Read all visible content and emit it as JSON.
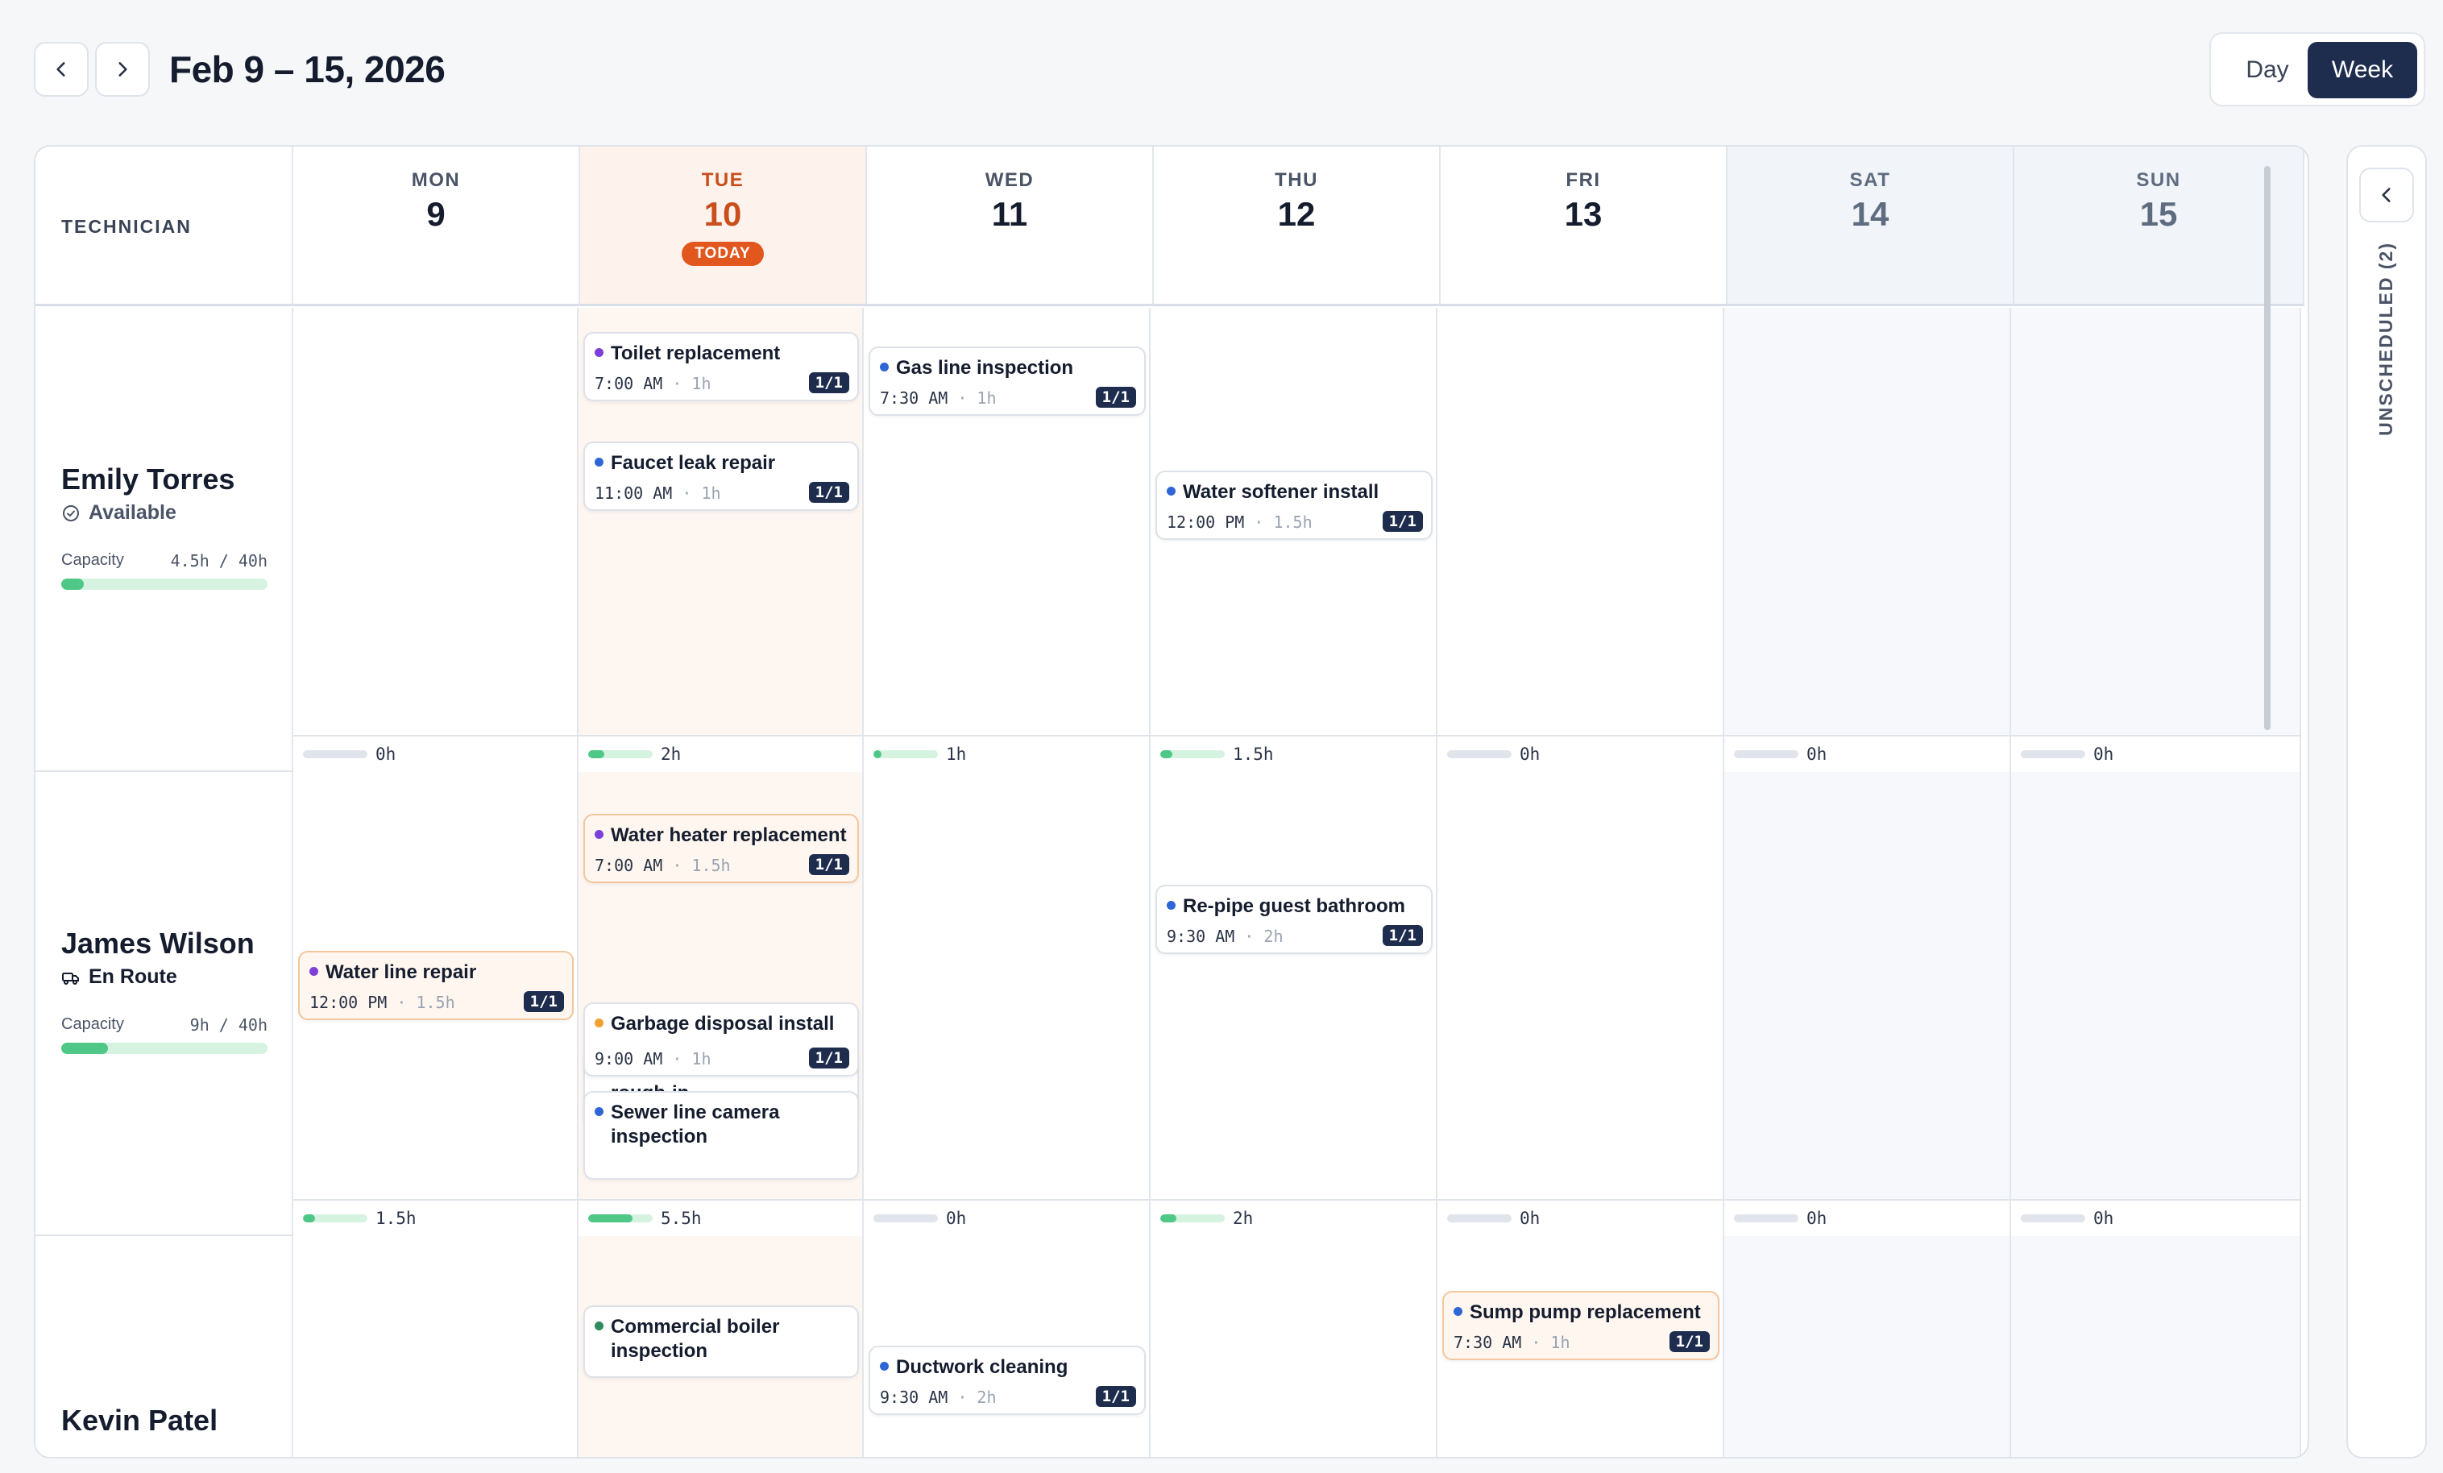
{
  "header": {
    "title": "Feb 9 – 15, 2026",
    "prev_icon": "chevron-left-icon",
    "next_icon": "chevron-right-icon"
  },
  "view_toggle": {
    "day": "Day",
    "week": "Week",
    "active": "Week"
  },
  "grid": {
    "tech_header": "TECHNICIAN",
    "days": [
      {
        "name": "MON",
        "date": "9",
        "today": false,
        "weekend": false
      },
      {
        "name": "TUE",
        "date": "10",
        "today": true,
        "weekend": false,
        "today_label": "TODAY"
      },
      {
        "name": "WED",
        "date": "11",
        "today": false,
        "weekend": false
      },
      {
        "name": "THU",
        "date": "12",
        "today": false,
        "weekend": false
      },
      {
        "name": "FRI",
        "date": "13",
        "today": false,
        "weekend": false
      },
      {
        "name": "SAT",
        "date": "14",
        "today": false,
        "weekend": true
      },
      {
        "name": "SUN",
        "date": "15",
        "today": false,
        "weekend": true
      }
    ]
  },
  "technicians": [
    {
      "name": "Emily Torres",
      "status": "Available",
      "status_icon": "check-circle-icon",
      "capacity_label": "Capacity",
      "capacity_value": "4.5h / 40h",
      "capacity_fraction": 0.11,
      "day_totals": [
        {
          "label": "0h",
          "fraction": 0
        },
        {
          "label": "2h",
          "fraction": 0.25
        },
        {
          "label": "1h",
          "fraction": 0.12
        },
        {
          "label": "1.5h",
          "fraction": 0.19
        },
        {
          "label": "0h",
          "fraction": 0
        },
        {
          "label": "0h",
          "fraction": 0
        },
        {
          "label": "0h",
          "fraction": 0
        }
      ],
      "jobs": [
        {
          "title": "Toilet replacement",
          "time": "7:00 AM",
          "duration": "1h",
          "badge": "1/1",
          "dot_color": "#7c3fd8",
          "highlight": false
        },
        {
          "title": "Faucet leak repair",
          "time": "11:00 AM",
          "duration": "1h",
          "badge": "1/1",
          "dot_color": "#2f66d6",
          "highlight": false
        },
        {
          "title": "Gas line inspection",
          "time": "7:30 AM",
          "duration": "1h",
          "badge": "1/1",
          "dot_color": "#2f66d6",
          "highlight": false
        },
        {
          "title": "Water softener install",
          "time": "12:00 PM",
          "duration": "1.5h",
          "badge": "1/1",
          "dot_color": "#2f66d6",
          "highlight": false
        }
      ]
    },
    {
      "name": "James Wilson",
      "status": "En Route",
      "status_icon": "truck-icon",
      "capacity_label": "Capacity",
      "capacity_value": "9h / 40h",
      "capacity_fraction": 0.225,
      "day_totals": [
        {
          "label": "1.5h",
          "fraction": 0.19
        },
        {
          "label": "5.5h",
          "fraction": 0.69
        },
        {
          "label": "0h",
          "fraction": 0
        },
        {
          "label": "2h",
          "fraction": 0.25
        },
        {
          "label": "0h",
          "fraction": 0
        },
        {
          "label": "0h",
          "fraction": 0
        },
        {
          "label": "0h",
          "fraction": 0
        }
      ],
      "jobs": [
        {
          "title": "Water line repair",
          "time": "12:00 PM",
          "duration": "1.5h",
          "badge": "1/1",
          "dot_color": "#7c3fd8",
          "highlight": true
        },
        {
          "title": "Bathroom remodel rough-in",
          "time": "",
          "duration": "",
          "badge": "",
          "dot_color": "#2f66d6",
          "highlight": false
        },
        {
          "title": "Sewer line camera inspection",
          "time": "",
          "duration": "",
          "badge": "",
          "dot_color": "#2f66d6",
          "highlight": false
        },
        {
          "title": "Garbage disposal install",
          "time": "9:00 AM",
          "duration": "1h",
          "badge": "1/1",
          "dot_color": "#f0a030",
          "highlight": false
        },
        {
          "title": "Water heater replacement",
          "time": "7:00 AM",
          "duration": "1.5h",
          "badge": "1/1",
          "dot_color": "#7c3fd8",
          "highlight": true
        },
        {
          "title": "Re-pipe guest bathroom",
          "time": "9:30 AM",
          "duration": "2h",
          "badge": "1/1",
          "dot_color": "#2f66d6",
          "highlight": false
        }
      ]
    },
    {
      "name": "Kevin Patel",
      "jobs": [
        {
          "title": "Commercial boiler inspection",
          "time": "",
          "duration": "",
          "badge": "",
          "dot_color": "#2f8a5e",
          "highlight": false
        },
        {
          "title": "Ductwork cleaning",
          "time": "9:30 AM",
          "duration": "2h",
          "badge": "1/1",
          "dot_color": "#2f66d6",
          "highlight": false
        },
        {
          "title": "Sump pump replacement",
          "time": "7:30 AM",
          "duration": "1h",
          "badge": "1/1",
          "dot_color": "#2f66d6",
          "highlight": true
        }
      ]
    }
  ],
  "unscheduled": {
    "label": "UNSCHEDULED (2)",
    "collapse_icon": "chevron-left-icon"
  }
}
